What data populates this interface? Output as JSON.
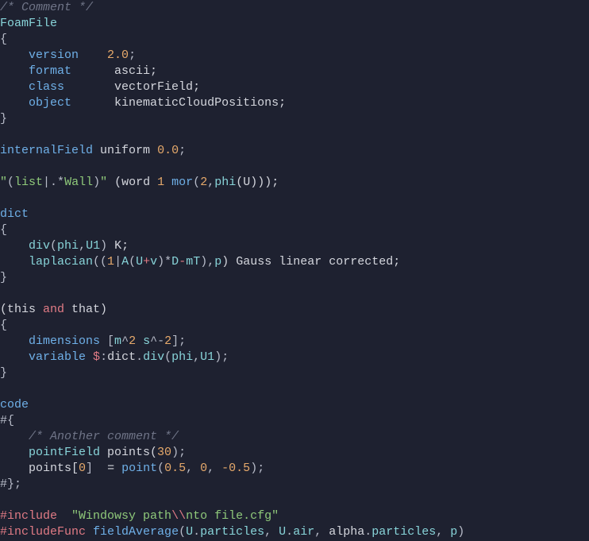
{
  "t": {
    "c1": "/* Comment */",
    "FoamFile": "FoamFile",
    "lbrace": "{",
    "rbrace": "}",
    "version": "version",
    "ver_num": "2.0",
    "semi": ";",
    "format": "format",
    "ascii": "ascii;",
    "class": "class",
    "vectorField": "vectorField;",
    "object": "object",
    "kcp": "kinematicCloudPositions;",
    "internalField": "internalField",
    "uniform": "uniform",
    "zero": "0.0",
    "q1": "\"",
    "lp": "(",
    "rp": ")",
    "list": "list",
    "pipe": "|.*",
    "Wall": "Wall",
    "word_lp": " (word ",
    "one": "1",
    "mor": "mor",
    "two": "2",
    "comma": ",",
    "phi": "phi",
    "U": "(U)));",
    "dict": "dict",
    "div": "div",
    "phiU1": "phi",
    "U1": "U1",
    "K": " K;",
    "laplacian": "laplacian",
    "open2": "((",
    "Aparen": "A",
    "Uplus": "U",
    "plus": "+",
    "v": "v",
    "closeStar": ")*",
    "D": "D",
    "minus": "-",
    "mT": "mT",
    "closecomma": "),",
    "p": "p",
    "gauss": ") Gauss linear corrected;",
    "this": "(this ",
    "and": "and",
    "that": " that)",
    "dimensions": "dimensions",
    "lbrack": " [",
    "m": "m",
    "caret2a": "^",
    "sp_s": " s",
    "caret_neg": "^-",
    "rbrack_semi": "];",
    "variable": "variable",
    "dollar": "$",
    "colon": ":",
    "dictword": "dict",
    "dot": ".",
    "divword": "div",
    "phiU1b": "phi",
    "U1b": "U1",
    "close_semi": ");",
    "code": "code",
    "hashlb": "#{",
    "c2": "/* Another comment */",
    "pointField": "pointField",
    "points": " points(",
    "thirty": "30",
    "points_idx": "    points[",
    "zeroi": "0",
    "rbrack": "]",
    "eq": "  = ",
    "point": "point",
    "pfive": "0.5",
    "zc": "0",
    "neg05": "-0.5",
    "hashrb": "#};",
    "include": "#include",
    "strpath1": "\"Windowsy path",
    "bsbs": "\\\\",
    "strpath2": "nto file.cfg\"",
    "includeFunc": "#includeFunc",
    "fieldAverage": "fieldAverage",
    "Udot": "U",
    "particles": "particles",
    "air": "air",
    "alpha": "alpha",
    "pend": "p"
  }
}
